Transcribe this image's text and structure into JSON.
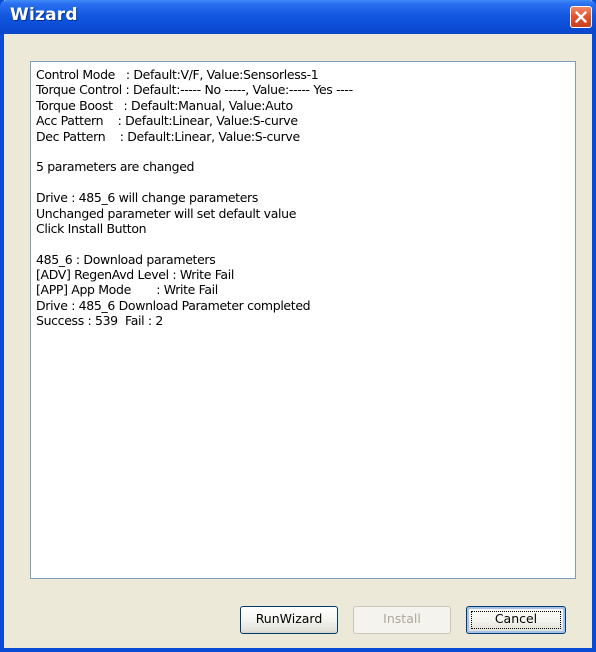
{
  "window": {
    "title": "Wizard"
  },
  "log": {
    "lines": [
      "Control Mode   : Default:V/F, Value:Sensorless-1",
      "Torque Control : Default:----- No -----, Value:----- Yes ----",
      "Torque Boost   : Default:Manual, Value:Auto",
      "Acc Pattern    : Default:Linear, Value:S-curve",
      "Dec Pattern    : Default:Linear, Value:S-curve",
      "",
      "5 parameters are changed",
      "",
      "Drive : 485_6 will change parameters",
      "Unchanged parameter will set default value",
      "Click Install Button",
      "",
      "485_6 : Download parameters",
      "[ADV] RegenAvd Level : Write Fail",
      "[APP] App Mode       : Write Fail",
      "Drive : 485_6 Download Parameter completed",
      "Success : 539  Fail : 2"
    ]
  },
  "buttons": {
    "run_wizard": "RunWizard",
    "install": "Install",
    "cancel": "Cancel"
  },
  "icons": {
    "close": "close-icon"
  },
  "colors": {
    "titlebar": "#0a4bd6",
    "close_button": "#e2552f",
    "dialog_background": "#ece9d8",
    "log_border": "#7f9db9",
    "disabled_text": "#aca899"
  }
}
